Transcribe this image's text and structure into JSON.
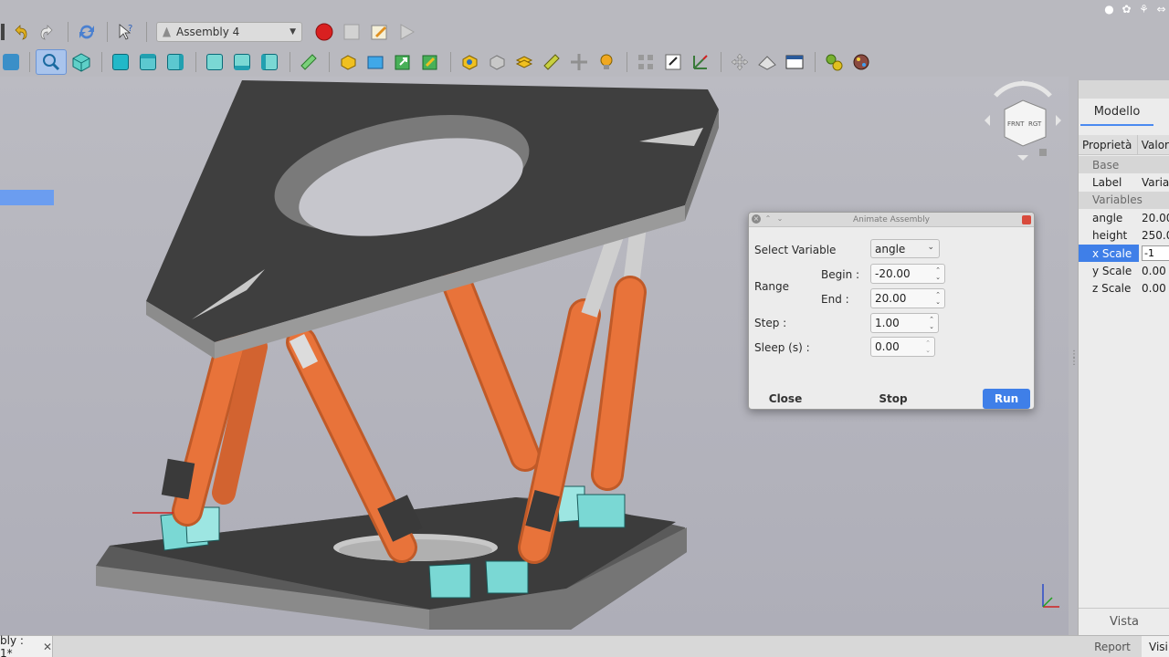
{
  "toolbar": {
    "workbench": "Assembly 4"
  },
  "model_panel": {
    "tab": "Modello",
    "col_property": "Proprietà",
    "col_value": "Valor",
    "groups": {
      "base": "Base",
      "variables": "Variables"
    },
    "rows": [
      {
        "key": "Label",
        "value": "Variab"
      },
      {
        "key": "angle",
        "value": "20.00"
      },
      {
        "key": "height",
        "value": "250.0"
      },
      {
        "key": "x Scale",
        "value": "-1"
      },
      {
        "key": "y Scale",
        "value": "0.00"
      },
      {
        "key": "z Scale",
        "value": "0.00"
      }
    ],
    "bottom_tab": "Vista"
  },
  "dialog": {
    "title": "Animate Assembly",
    "select_variable_label": "Select Variable",
    "select_variable_value": "angle",
    "range_label": "Range",
    "begin_label": "Begin :",
    "begin_value": "-20.00",
    "end_label": "End :",
    "end_value": "20.00",
    "step_label": "Step :",
    "step_value": "1.00",
    "sleep_label": "Sleep (s) :",
    "sleep_value": "0.00",
    "close": "Close",
    "stop": "Stop",
    "run": "Run"
  },
  "bottom_bar": {
    "doc_tab": "bly : 1*",
    "report_tab": "Report",
    "vis_tab": "Visi"
  },
  "colors": {
    "accent": "#3f7fe8",
    "leg_orange": "#e8733a",
    "foot_cyan": "#7ad8d4",
    "plate_dark": "#3f3f3f"
  }
}
